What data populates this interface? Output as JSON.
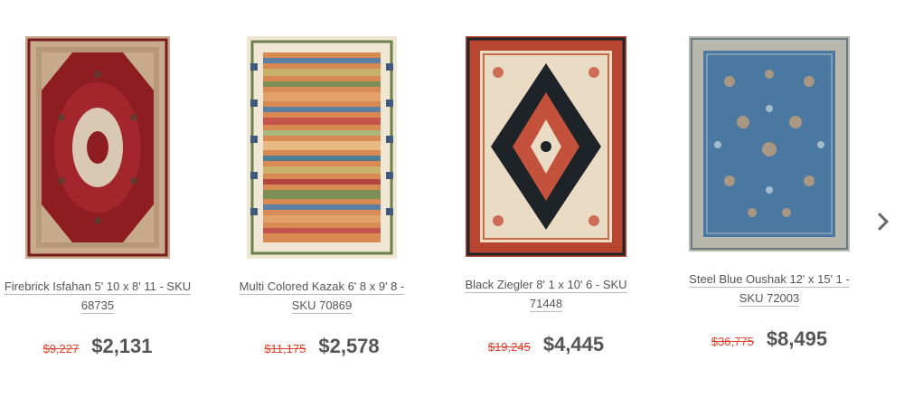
{
  "products": [
    {
      "title": "Firebrick Isfahan 5' 10 x 8' 11 - SKU 68735",
      "old_price": "$9,227",
      "price": "$2,131",
      "image": "firebrick-isfahan-rug-image",
      "colors": {
        "ground": "#8e1d22",
        "border": "#c8ab8c",
        "medallion": "#d9c8b4"
      }
    },
    {
      "title": "Multi Colored Kazak 6' 8 x 9' 8 - SKU 70869",
      "old_price": "$11,175",
      "price": "$2,578",
      "image": "multi-colored-kazak-rug-image",
      "colors": {
        "ground": "#d98a52",
        "border": "#efe6d3",
        "accent": "#5c7fa3"
      }
    },
    {
      "title": "Black Ziegler 8' 1 x 10' 6 - SKU 71448",
      "old_price": "$19,245",
      "price": "$4,445",
      "image": "black-ziegler-rug-image",
      "colors": {
        "ground": "#eadcc4",
        "border": "#b8452f",
        "medallion": "#1e2328"
      }
    },
    {
      "title": "Steel Blue Oushak 12' x 15' 1 - SKU 72003",
      "old_price": "$36,775",
      "price": "$8,495",
      "image": "steel-blue-oushak-rug-image",
      "colors": {
        "ground": "#4a78a0",
        "border": "#b9b8ae",
        "accent": "#c9a07a"
      }
    }
  ],
  "carousel": {
    "next_icon": "chevron-right-icon"
  },
  "theme": {
    "sale_color": "#e2412e",
    "price_color": "#555555"
  }
}
